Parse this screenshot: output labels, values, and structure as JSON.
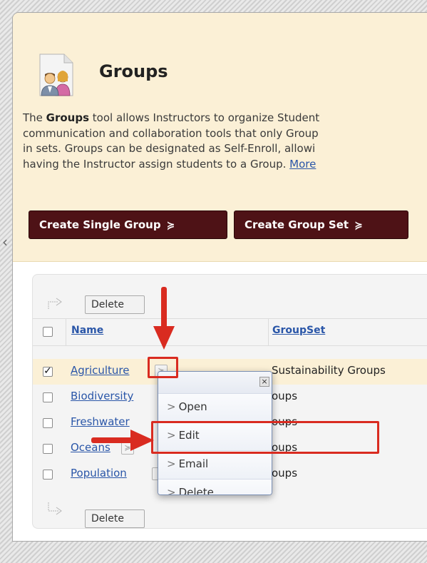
{
  "page": {
    "title": "Groups",
    "description_lines": [
      {
        "pre": "The ",
        "bold": "Groups",
        "post": " tool allows Instructors to organize Student"
      },
      {
        "text": "communication and collaboration tools that only Group"
      },
      {
        "text": "in sets. Groups can be designated as Self-Enroll, allowi"
      },
      {
        "pre": "having the Instructor assign students to a Group. ",
        "link": "More"
      }
    ]
  },
  "toolbar": {
    "create_single_group": "Create Single Group",
    "create_group_set": "Create Group Set",
    "chevron_glyph": "≽"
  },
  "list": {
    "delete_label": "Delete",
    "columns": {
      "name": "Name",
      "groupset": "GroupSet"
    },
    "rows": [
      {
        "name": "Agriculture",
        "groupset": "Sustainability Groups",
        "checked": true
      },
      {
        "name": "Biodiversity",
        "groupset": "oups",
        "checked": false
      },
      {
        "name": "Freshwater",
        "groupset": "oups",
        "checked": false
      },
      {
        "name": "Oceans",
        "groupset": "oups",
        "checked": false
      },
      {
        "name": "Population",
        "groupset": "oups",
        "checked": false
      }
    ],
    "checkmark": "✓"
  },
  "context_menu": {
    "close_glyph": "×",
    "items": [
      "Open",
      "Edit",
      "Email",
      "Delete"
    ],
    "arrow_glyph": ">"
  },
  "colors": {
    "header_bg": "#fbf0d6",
    "button_bg": "#4e1216",
    "link": "#2a56a8",
    "highlight_row": "#fbf0d6",
    "annotation_red": "#d92b20"
  },
  "icons": [
    "groups-people-icon",
    "chevron-down-icon",
    "corner-arrow-icon",
    "close-icon",
    "collapse-left-icon"
  ]
}
